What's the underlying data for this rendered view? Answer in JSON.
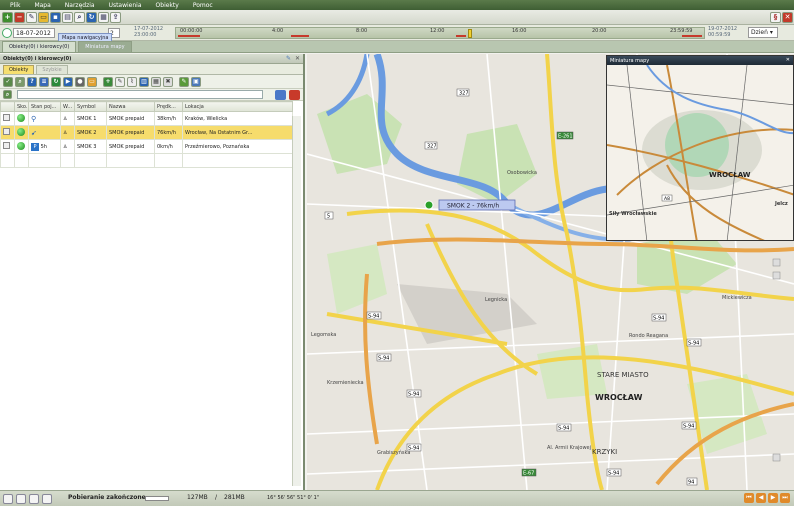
{
  "menu": [
    "Plik",
    "Mapa",
    "Narzędzia",
    "Ustawienia",
    "Obiekty",
    "Pomoc"
  ],
  "timebar": {
    "date_from": "18-07-2012",
    "tooltip": "Mapa nawigacyjna",
    "date_from_suffix": "2",
    "left_label_date": "17-07-2012",
    "left_label_time": "23:00:00",
    "ticks": [
      "00:00:00",
      "4:00",
      "8:00",
      "12:00",
      "16:00",
      "20:00",
      "23:59:59"
    ],
    "right_label_date": "19-07-2012",
    "right_label_time": "00:59:59",
    "period": "Dzień"
  },
  "window_tabs": [
    "Obiekty(0) i kierowcy(0)",
    "Miniatura mapy"
  ],
  "panel": {
    "title": "Obiekty(0) i kierowcy(0)",
    "subtabs": [
      "Obiekty",
      "Szybkie"
    ],
    "columns": [
      "",
      "Sko...",
      "Stan poj...",
      "W...",
      "Symbol",
      "Nazwa",
      "Prędk...",
      "Lokacja"
    ],
    "rows": [
      {
        "symbol": "SMOK 1",
        "name": "SMOK prepaid",
        "speed": "38km/h",
        "location": "Kraków, Wielicka",
        "state": "",
        "selected": false
      },
      {
        "symbol": "SMOK 2",
        "name": "SMOK prepaid",
        "speed": "76km/h",
        "location": "Wrocław, Na Ostatnim Gr...",
        "state": "",
        "selected": true
      },
      {
        "symbol": "SMOK 3",
        "name": "SMOK prepaid",
        "speed": "0km/h",
        "location": "Przeźmierowo, Poznańska",
        "state": "5h",
        "selected": false
      }
    ]
  },
  "map": {
    "vehicle_label": "SMOK 2 - 76km/h",
    "labels": {
      "city": "WROCŁAW",
      "old_town": "STARE MIASTO",
      "krzyki": "KRZYKI",
      "rondo": "Rondo Reagana",
      "legnicka": "Legnicka",
      "krzemieniecka": "Krzemieniecka",
      "legomska": "Legomska",
      "osobowicka": "Osobowicka",
      "grabiszynska": "Grabiszyńska",
      "armii_krajowej": "Al. Armii Krajowej",
      "mickiewicza": "Mickiewicza"
    },
    "road_numbers": [
      "327",
      "327",
      "5",
      "S-94",
      "S-94",
      "S-94",
      "E-261",
      "E-67",
      "S-94",
      "S-94",
      "S-94",
      "S-94",
      "S-94",
      "S-94",
      "94",
      "A8"
    ]
  },
  "minimap": {
    "title": "Miniatura mapy",
    "city": "WROCŁAW",
    "suburb": "Siły Wrocławskie",
    "edge": "Jelcz",
    "road": "A8"
  },
  "status": {
    "message": "Pobieranie zakończone",
    "mem_used": "127MB",
    "mem_total": "281MB",
    "coords": "16° 56' 56\" 51° 0' 1\""
  }
}
